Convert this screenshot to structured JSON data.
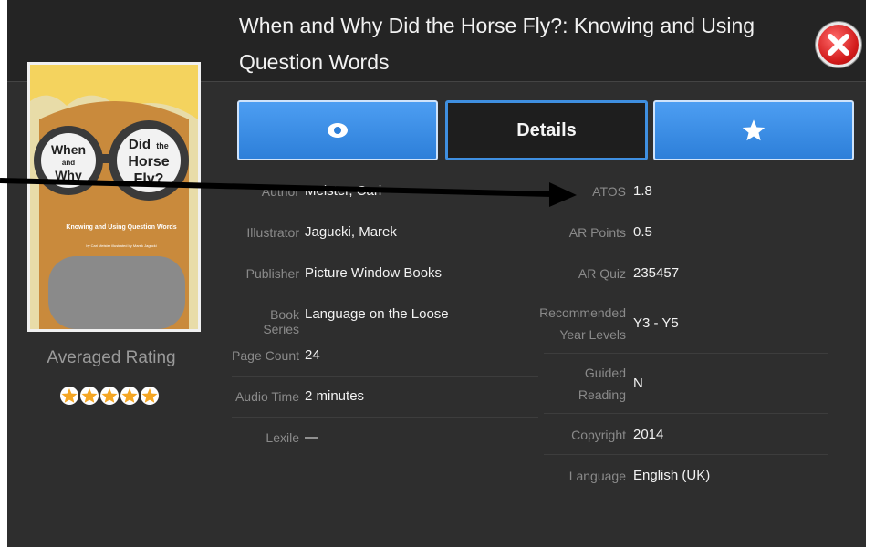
{
  "header": {
    "title": "When and Why Did the Horse Fly?: Knowing and Using Question Words"
  },
  "cover": {
    "line1": "When",
    "line2": "and",
    "line3": "Why",
    "line4": "Did",
    "line5": "the",
    "line6": "Horse",
    "line7": "Fly?",
    "subtitle": "Knowing and Using Question Words",
    "credit": "by Cari Meister illustrated by Marek Jagucki"
  },
  "rating": {
    "label": "Averaged Rating",
    "stars": 5
  },
  "tabs": {
    "preview_icon": "eye-icon",
    "details_label": "Details",
    "favourite_icon": "star-icon"
  },
  "details_left": [
    {
      "label": "Author",
      "value": "Meister, Cari"
    },
    {
      "label": "Illustrator",
      "value": "Jagucki, Marek"
    },
    {
      "label": "Publisher",
      "value": "Picture Window Books"
    },
    {
      "label": "Book Series",
      "value": "Language on the Loose"
    },
    {
      "label": "Page Count",
      "value": "24"
    },
    {
      "label": "Audio Time",
      "value": "2 minutes"
    },
    {
      "label": "Lexile",
      "value": "—"
    }
  ],
  "details_right": [
    {
      "label": "ATOS",
      "value": "1.8"
    },
    {
      "label": "AR Points",
      "value": "0.5"
    },
    {
      "label": "AR Quiz",
      "value": "235457"
    },
    {
      "label_line1": "Recommended",
      "label_line2": "Year Levels",
      "value": "Y3 - Y5"
    },
    {
      "label_line1": "Guided",
      "label_line2": "Reading",
      "value": "N"
    },
    {
      "label": "Copyright",
      "value": "2014"
    },
    {
      "label": "Language",
      "value": "English (UK)"
    }
  ],
  "colors": {
    "accent_blue": "#2d7fd9",
    "star_orange": "#f5a623",
    "close_red": "#d11a1a"
  }
}
